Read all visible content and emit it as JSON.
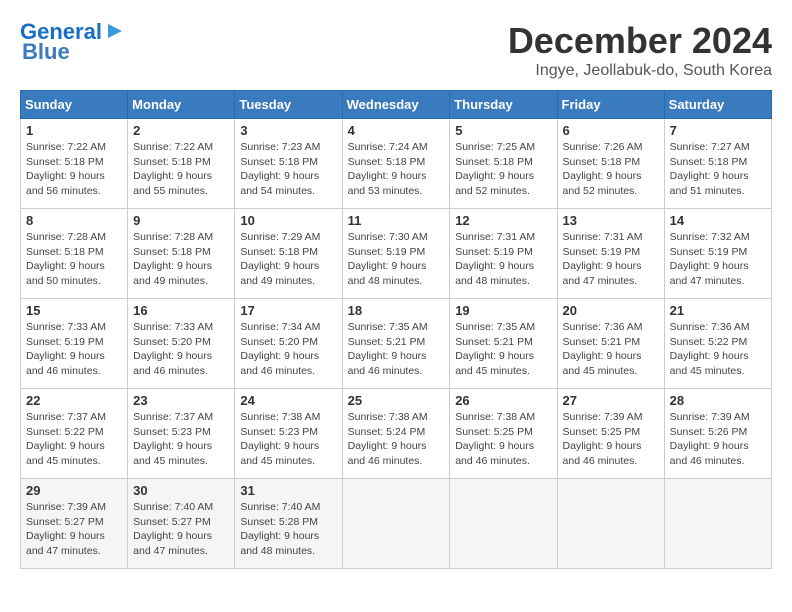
{
  "logo": {
    "line1": "General",
    "line2": "Blue"
  },
  "header": {
    "title": "December 2024",
    "location": "Ingye, Jeollabuk-do, South Korea"
  },
  "weekdays": [
    "Sunday",
    "Monday",
    "Tuesday",
    "Wednesday",
    "Thursday",
    "Friday",
    "Saturday"
  ],
  "weeks": [
    [
      {
        "day": "1",
        "sunrise": "7:22 AM",
        "sunset": "5:18 PM",
        "daylight": "9 hours and 56 minutes."
      },
      {
        "day": "2",
        "sunrise": "7:22 AM",
        "sunset": "5:18 PM",
        "daylight": "9 hours and 55 minutes."
      },
      {
        "day": "3",
        "sunrise": "7:23 AM",
        "sunset": "5:18 PM",
        "daylight": "9 hours and 54 minutes."
      },
      {
        "day": "4",
        "sunrise": "7:24 AM",
        "sunset": "5:18 PM",
        "daylight": "9 hours and 53 minutes."
      },
      {
        "day": "5",
        "sunrise": "7:25 AM",
        "sunset": "5:18 PM",
        "daylight": "9 hours and 52 minutes."
      },
      {
        "day": "6",
        "sunrise": "7:26 AM",
        "sunset": "5:18 PM",
        "daylight": "9 hours and 52 minutes."
      },
      {
        "day": "7",
        "sunrise": "7:27 AM",
        "sunset": "5:18 PM",
        "daylight": "9 hours and 51 minutes."
      }
    ],
    [
      {
        "day": "8",
        "sunrise": "7:28 AM",
        "sunset": "5:18 PM",
        "daylight": "9 hours and 50 minutes."
      },
      {
        "day": "9",
        "sunrise": "7:28 AM",
        "sunset": "5:18 PM",
        "daylight": "9 hours and 49 minutes."
      },
      {
        "day": "10",
        "sunrise": "7:29 AM",
        "sunset": "5:18 PM",
        "daylight": "9 hours and 49 minutes."
      },
      {
        "day": "11",
        "sunrise": "7:30 AM",
        "sunset": "5:19 PM",
        "daylight": "9 hours and 48 minutes."
      },
      {
        "day": "12",
        "sunrise": "7:31 AM",
        "sunset": "5:19 PM",
        "daylight": "9 hours and 48 minutes."
      },
      {
        "day": "13",
        "sunrise": "7:31 AM",
        "sunset": "5:19 PM",
        "daylight": "9 hours and 47 minutes."
      },
      {
        "day": "14",
        "sunrise": "7:32 AM",
        "sunset": "5:19 PM",
        "daylight": "9 hours and 47 minutes."
      }
    ],
    [
      {
        "day": "15",
        "sunrise": "7:33 AM",
        "sunset": "5:19 PM",
        "daylight": "9 hours and 46 minutes."
      },
      {
        "day": "16",
        "sunrise": "7:33 AM",
        "sunset": "5:20 PM",
        "daylight": "9 hours and 46 minutes."
      },
      {
        "day": "17",
        "sunrise": "7:34 AM",
        "sunset": "5:20 PM",
        "daylight": "9 hours and 46 minutes."
      },
      {
        "day": "18",
        "sunrise": "7:35 AM",
        "sunset": "5:21 PM",
        "daylight": "9 hours and 46 minutes."
      },
      {
        "day": "19",
        "sunrise": "7:35 AM",
        "sunset": "5:21 PM",
        "daylight": "9 hours and 45 minutes."
      },
      {
        "day": "20",
        "sunrise": "7:36 AM",
        "sunset": "5:21 PM",
        "daylight": "9 hours and 45 minutes."
      },
      {
        "day": "21",
        "sunrise": "7:36 AM",
        "sunset": "5:22 PM",
        "daylight": "9 hours and 45 minutes."
      }
    ],
    [
      {
        "day": "22",
        "sunrise": "7:37 AM",
        "sunset": "5:22 PM",
        "daylight": "9 hours and 45 minutes."
      },
      {
        "day": "23",
        "sunrise": "7:37 AM",
        "sunset": "5:23 PM",
        "daylight": "9 hours and 45 minutes."
      },
      {
        "day": "24",
        "sunrise": "7:38 AM",
        "sunset": "5:23 PM",
        "daylight": "9 hours and 45 minutes."
      },
      {
        "day": "25",
        "sunrise": "7:38 AM",
        "sunset": "5:24 PM",
        "daylight": "9 hours and 46 minutes."
      },
      {
        "day": "26",
        "sunrise": "7:38 AM",
        "sunset": "5:25 PM",
        "daylight": "9 hours and 46 minutes."
      },
      {
        "day": "27",
        "sunrise": "7:39 AM",
        "sunset": "5:25 PM",
        "daylight": "9 hours and 46 minutes."
      },
      {
        "day": "28",
        "sunrise": "7:39 AM",
        "sunset": "5:26 PM",
        "daylight": "9 hours and 46 minutes."
      }
    ],
    [
      {
        "day": "29",
        "sunrise": "7:39 AM",
        "sunset": "5:27 PM",
        "daylight": "9 hours and 47 minutes."
      },
      {
        "day": "30",
        "sunrise": "7:40 AM",
        "sunset": "5:27 PM",
        "daylight": "9 hours and 47 minutes."
      },
      {
        "day": "31",
        "sunrise": "7:40 AM",
        "sunset": "5:28 PM",
        "daylight": "9 hours and 48 minutes."
      },
      null,
      null,
      null,
      null
    ]
  ],
  "labels": {
    "sunrise": "Sunrise:",
    "sunset": "Sunset:",
    "daylight": "Daylight:"
  }
}
